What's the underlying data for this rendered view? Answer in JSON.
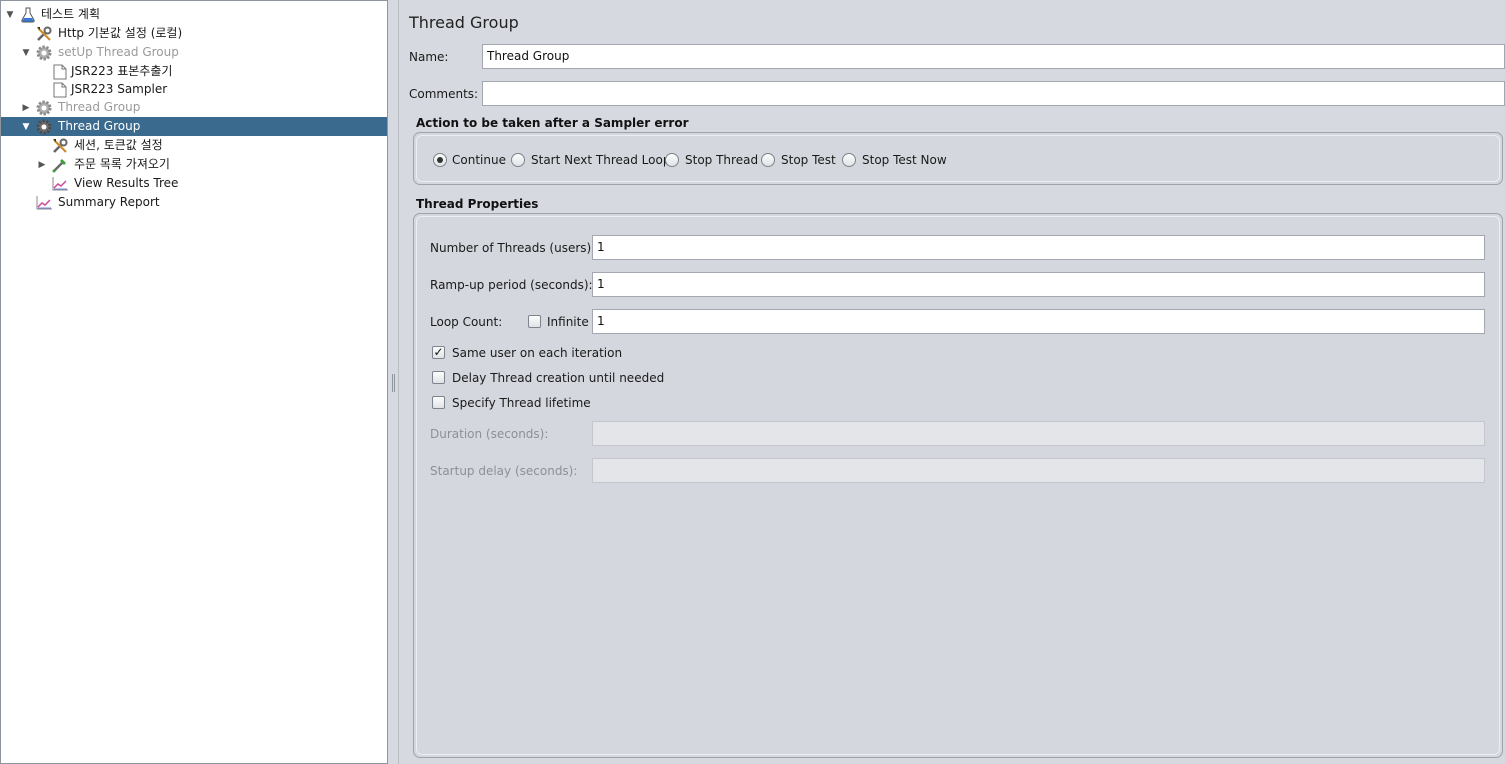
{
  "tree": {
    "items": [
      {
        "label": "테스트 계획",
        "icon": "flask-icon",
        "expanded": true
      },
      {
        "label": "Http 기본값 설정 (로컬)",
        "icon": "wrench-icon"
      },
      {
        "label": "setUp Thread Group",
        "icon": "gear-icon",
        "expanded": true,
        "disabled": true
      },
      {
        "label": "JSR223 표본추출기",
        "icon": "document-icon"
      },
      {
        "label": "JSR223 Sampler",
        "icon": "document-icon"
      },
      {
        "label": "Thread Group",
        "icon": "gear-icon",
        "expanded": false,
        "disabled": true
      },
      {
        "label": "Thread Group",
        "icon": "gear-icon",
        "expanded": true,
        "selected": true
      },
      {
        "label": "세션, 토큰값 설정",
        "icon": "wrench-icon"
      },
      {
        "label": "주문 목록 가져오기",
        "icon": "pipette-icon",
        "expanded": false
      },
      {
        "label": "View Results Tree",
        "icon": "graph-icon"
      },
      {
        "label": "Summary Report",
        "icon": "graph-icon"
      }
    ]
  },
  "panel": {
    "title": "Thread Group",
    "name_label": "Name:",
    "name_value": "Thread Group",
    "comments_label": "Comments:",
    "comments_value": "",
    "error_group": {
      "title": "Action to be taken after a Sampler error",
      "options": [
        "Continue",
        "Start Next Thread Loop",
        "Stop Thread",
        "Stop Test",
        "Stop Test Now"
      ],
      "selected": "Continue"
    },
    "props": {
      "title": "Thread Properties",
      "threads_label": "Number of Threads (users):",
      "threads_value": "1",
      "rampup_label": "Ramp-up period (seconds):",
      "rampup_value": "1",
      "loop_label": "Loop Count:",
      "infinite_label": "Infinite",
      "infinite_checked": false,
      "loop_value": "1",
      "same_user_label": "Same user on each iteration",
      "same_user_checked": true,
      "delay_label": "Delay Thread creation until needed",
      "delay_checked": false,
      "lifetime_label": "Specify Thread lifetime",
      "lifetime_checked": false,
      "duration_label": "Duration (seconds):",
      "duration_value": "",
      "startup_label": "Startup delay (seconds):",
      "startup_value": ""
    }
  },
  "colors": {
    "selection": "#3b6a8f",
    "panel_bg": "#d6d9df"
  }
}
